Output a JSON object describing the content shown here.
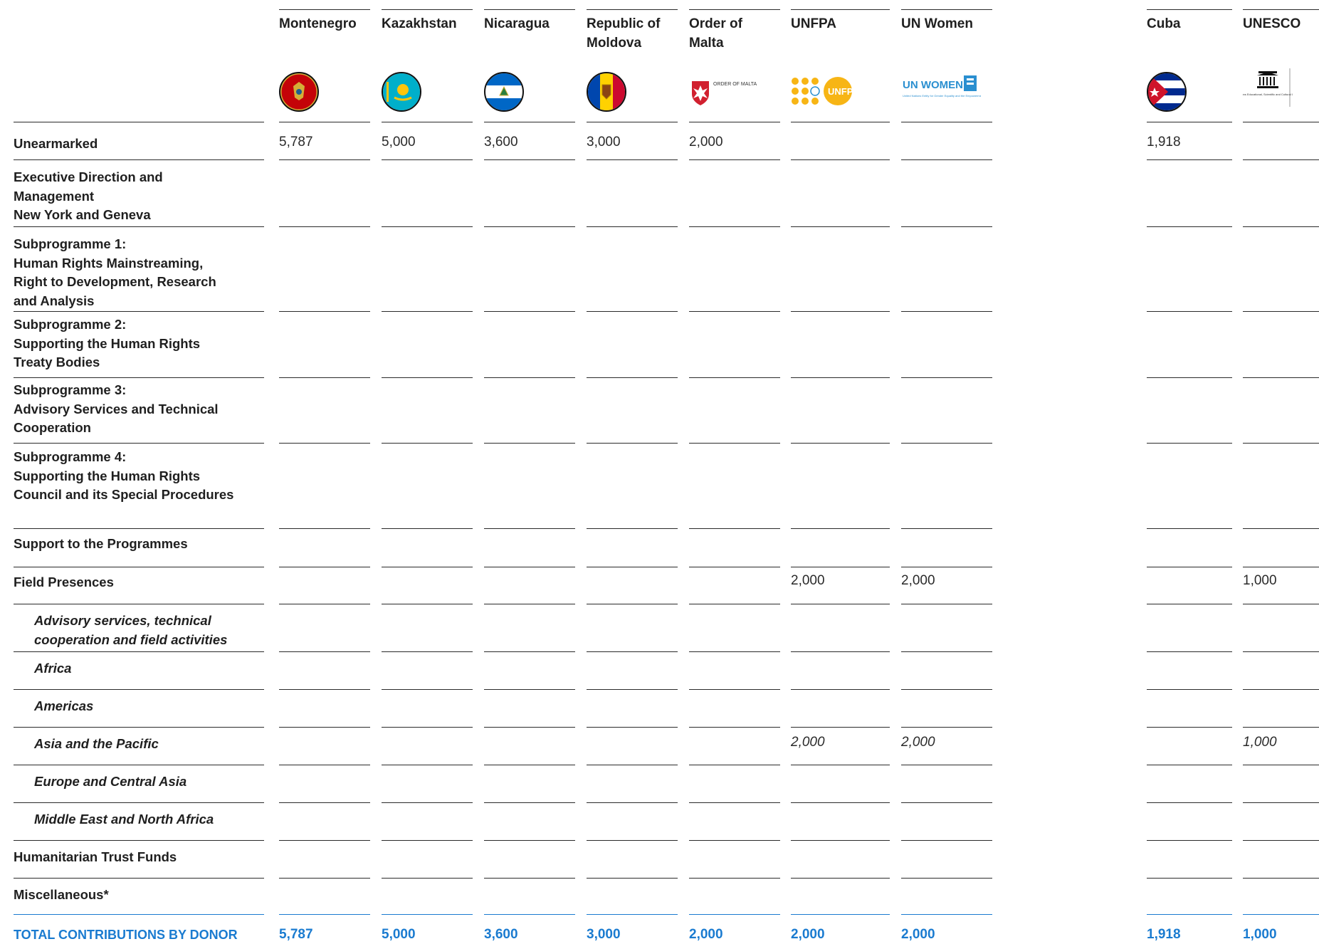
{
  "columns": [
    {
      "name": "Montenegro",
      "logo": "montenegro-flag-icon"
    },
    {
      "name": "Kazakhstan",
      "logo": "kazakhstan-flag-icon"
    },
    {
      "name": "Nicaragua",
      "logo": "nicaragua-flag-icon"
    },
    {
      "name": "Republic of\nMoldova",
      "logo": "moldova-flag-icon"
    },
    {
      "name": "Order of\nMalta",
      "logo": "order-of-malta-logo",
      "logo_text": "ORDER OF MALTA"
    },
    {
      "name": "UNFPA",
      "logo": "unfpa-logo",
      "logo_text": "UNFPA"
    },
    {
      "name": "UN Women",
      "logo": "un-women-logo",
      "logo_text": "UN WOMEN",
      "logo_subtext": "United Nations Entity for Gender Equality and the Empowerment of Women"
    },
    {
      "name": "Cuba",
      "logo": "cuba-flag-icon"
    },
    {
      "name": "UNESCO",
      "logo": "unesco-logo",
      "logo_subtext": "United Nations Educational, Scientific and Cultural Organization"
    }
  ],
  "rows": [
    {
      "label": "Unearmarked",
      "italic": false,
      "values": [
        "5,787",
        "5,000",
        "3,600",
        "3,000",
        "2,000",
        "",
        "",
        "1,918",
        ""
      ]
    },
    {
      "label": "Executive Direction and\nManagement\nNew York and Geneva",
      "italic": false,
      "values": [
        "",
        "",
        "",
        "",
        "",
        "",
        "",
        "",
        ""
      ]
    },
    {
      "label": "Subprogramme 1:\nHuman Rights Mainstreaming,\nRight to Development, Research\nand Analysis",
      "italic": false,
      "values": [
        "",
        "",
        "",
        "",
        "",
        "",
        "",
        "",
        ""
      ]
    },
    {
      "label": "Subprogramme 2:\nSupporting the Human Rights\nTreaty Bodies",
      "italic": false,
      "values": [
        "",
        "",
        "",
        "",
        "",
        "",
        "",
        "",
        ""
      ]
    },
    {
      "label": "Subprogramme 3:\nAdvisory Services and Technical\nCooperation",
      "italic": false,
      "values": [
        "",
        "",
        "",
        "",
        "",
        "",
        "",
        "",
        ""
      ]
    },
    {
      "label": "Subprogramme 4:\nSupporting the Human Rights\nCouncil and its Special Procedures",
      "italic": false,
      "values": [
        "",
        "",
        "",
        "",
        "",
        "",
        "",
        "",
        ""
      ]
    },
    {
      "label": "Support to the Programmes",
      "italic": false,
      "values": [
        "",
        "",
        "",
        "",
        "",
        "",
        "",
        "",
        ""
      ]
    },
    {
      "label": "Field Presences",
      "italic": false,
      "values": [
        "",
        "",
        "",
        "",
        "",
        "2,000",
        "2,000",
        "",
        "1,000"
      ]
    },
    {
      "label": "Advisory services, technical\ncooperation and field activities",
      "italic": true,
      "values": [
        "",
        "",
        "",
        "",
        "",
        "",
        "",
        "",
        ""
      ]
    },
    {
      "label": "Africa",
      "italic": true,
      "values": [
        "",
        "",
        "",
        "",
        "",
        "",
        "",
        "",
        ""
      ]
    },
    {
      "label": "Americas",
      "italic": true,
      "values": [
        "",
        "",
        "",
        "",
        "",
        "",
        "",
        "",
        ""
      ]
    },
    {
      "label": "Asia and the Pacific",
      "italic": true,
      "values": [
        "",
        "",
        "",
        "",
        "",
        "2,000",
        "2,000",
        "",
        "1,000"
      ]
    },
    {
      "label": "Europe and Central Asia",
      "italic": true,
      "values": [
        "",
        "",
        "",
        "",
        "",
        "",
        "",
        "",
        ""
      ]
    },
    {
      "label": "Middle East and North Africa",
      "italic": true,
      "values": [
        "",
        "",
        "",
        "",
        "",
        "",
        "",
        "",
        ""
      ]
    },
    {
      "label": "Humanitarian Trust Funds",
      "italic": false,
      "values": [
        "",
        "",
        "",
        "",
        "",
        "",
        "",
        "",
        ""
      ]
    },
    {
      "label": "Miscellaneous*",
      "italic": false,
      "values": [
        "",
        "",
        "",
        "",
        "",
        "",
        "",
        "",
        ""
      ]
    }
  ],
  "total": {
    "label": "TOTAL CONTRIBUTIONS BY DONOR",
    "values": [
      "5,787",
      "5,000",
      "3,600",
      "3,000",
      "2,000",
      "2,000",
      "2,000",
      "1,918",
      "1,000"
    ]
  },
  "colors": {
    "accent": "#1a7bd0",
    "text": "#1f1f1f",
    "rule": "#2a2a2a"
  }
}
